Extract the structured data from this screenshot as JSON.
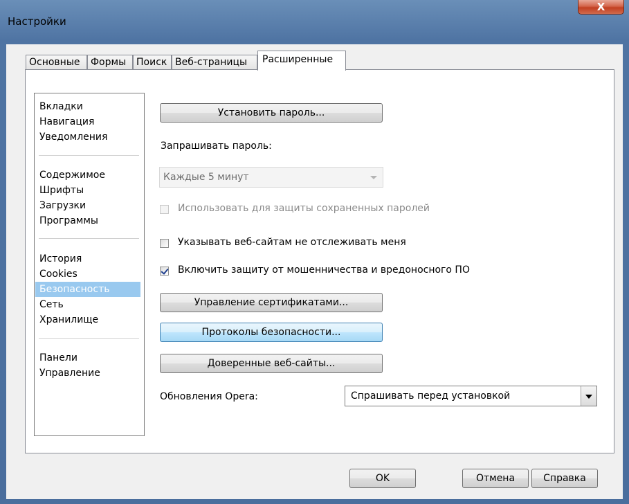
{
  "window": {
    "title": "Настройки",
    "close_glyph": "X"
  },
  "tabs": [
    {
      "label": "Основные"
    },
    {
      "label": "Формы"
    },
    {
      "label": "Поиск"
    },
    {
      "label": "Веб-страницы"
    },
    {
      "label": "Расширенные",
      "active": true
    }
  ],
  "sidebar": {
    "groups": [
      [
        "Вкладки",
        "Навигация",
        "Уведомления"
      ],
      [
        "Содержимое",
        "Шрифты",
        "Загрузки",
        "Программы"
      ],
      [
        "История",
        "Cookies",
        "Безопасность",
        "Сеть",
        "Хранилище"
      ],
      [
        "Панели",
        "Управление"
      ]
    ],
    "selected": "Безопасность"
  },
  "security": {
    "set_password_button": "Установить пароль...",
    "ask_password_label": "Запрашивать пароль:",
    "password_interval": {
      "value": "Каждые 5 минут",
      "disabled": true
    },
    "use_for_saved_passwords": {
      "label": "Использовать для защиты сохраненных паролей",
      "checked": false,
      "disabled": true
    },
    "do_not_track": {
      "label": "Указывать веб-сайтам не отслеживать меня",
      "checked": false
    },
    "fraud_protection": {
      "label": "Включить защиту от мошенничества и вредоносного ПО",
      "checked": true
    },
    "manage_certificates_button": "Управление сертификатами...",
    "security_protocols_button": "Протоколы безопасности...",
    "trusted_websites_button": "Доверенные веб-сайты...",
    "opera_updates_label": "Обновления Opera:",
    "opera_updates_select": "Спрашивать перед установкой"
  },
  "footer": {
    "ok": "OK",
    "cancel": "Отмена",
    "help": "Справка"
  },
  "colors": {
    "titlebar": "#4f74a3",
    "selection": "#99c9ef",
    "close_button": "#c23f22",
    "hover_button": "#bee6fd"
  }
}
